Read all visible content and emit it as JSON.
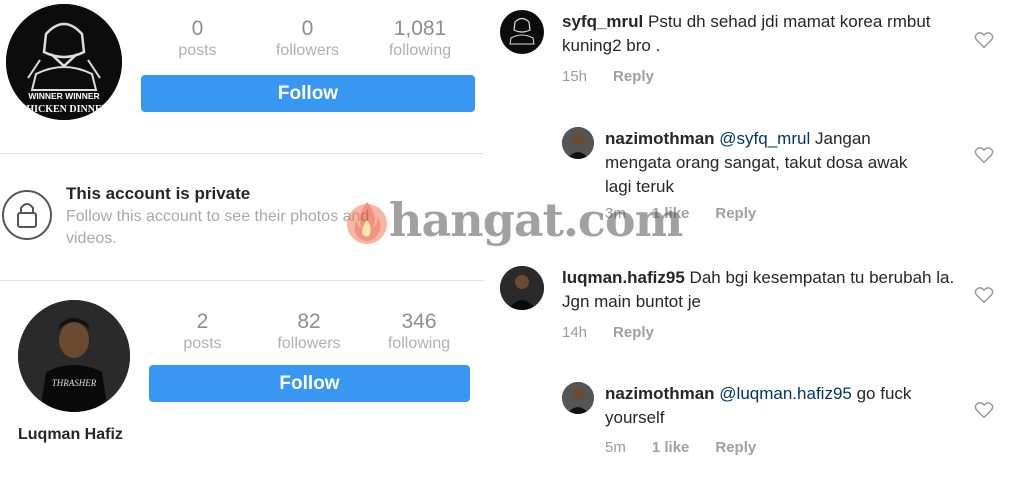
{
  "profile1": {
    "avatar_text_top": "WINNER WINNER",
    "avatar_text_bottom": "CHICKEN DINNER",
    "stats": [
      {
        "num": "0",
        "label": "posts"
      },
      {
        "num": "0",
        "label": "followers"
      },
      {
        "num": "1,081",
        "label": "following"
      }
    ],
    "follow_label": "Follow"
  },
  "private": {
    "title": "This account is private",
    "description": "Follow this account to see their photos and videos."
  },
  "profile2": {
    "name": "Luqman Hafiz",
    "shirt_text": "THRASHER",
    "stats": [
      {
        "num": "2",
        "label": "posts"
      },
      {
        "num": "82",
        "label": "followers"
      },
      {
        "num": "346",
        "label": "following"
      }
    ],
    "follow_label": "Follow"
  },
  "comments": [
    {
      "user": "syfq_mrul",
      "mention": "",
      "text": "Pstu dh sehad jdi mamat korea rmbut kuning2 bro .",
      "time": "15h",
      "likes": "",
      "reply": "Reply"
    },
    {
      "user": "nazimothman",
      "mention": "@syfq_mrul",
      "text": "Jangan mengata orang sangat, takut dosa awak lagi teruk",
      "time": "3m",
      "likes": "1 like",
      "reply": "Reply"
    },
    {
      "user": "luqman.hafiz95",
      "mention": "",
      "text": "Dah bgi kesempatan tu berubah la. Jgn main buntot je",
      "time": "14h",
      "likes": "",
      "reply": "Reply"
    },
    {
      "user": "nazimothman",
      "mention": "@luqman.hafiz95",
      "text": "go fuck yourself",
      "time": "5m",
      "likes": "1 like",
      "reply": "Reply"
    }
  ],
  "watermark": "hangat.com",
  "colors": {
    "follow_button": "#3897f0",
    "mention": "#003569"
  }
}
